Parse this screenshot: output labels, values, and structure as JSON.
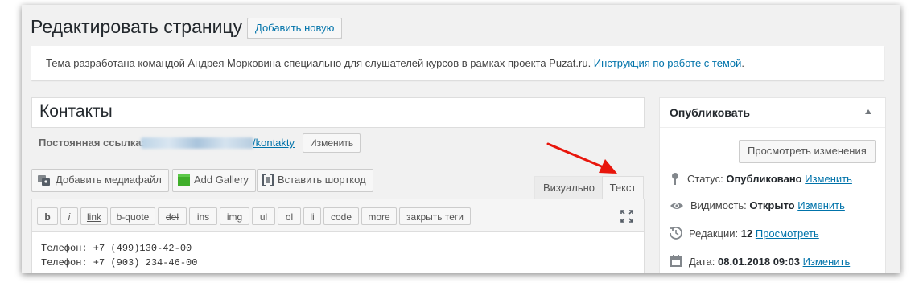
{
  "header": {
    "title": "Редактировать страницу",
    "add_new_label": "Добавить новую"
  },
  "notice": {
    "text": "Тема разработана командой Андрея Морковина специально для слушателей курсов в рамках проекта Puzat.ru. ",
    "link": "Инструкция по работе с темой",
    "suffix": "."
  },
  "post": {
    "title": "Контакты",
    "permalink_label": "Постоянная ссылка:",
    "permalink_slug": "/kontakty",
    "edit_link_label": "Изменить"
  },
  "media_buttons": {
    "add_media": "Добавить медиафайл",
    "add_gallery": "Add Gallery",
    "insert_shortcode": "Вставить шорткод"
  },
  "editor_tabs": {
    "visual": "Визуально",
    "text": "Текст",
    "active": "text"
  },
  "quicktags": [
    "b",
    "i",
    "link",
    "b-quote",
    "del",
    "ins",
    "img",
    "ul",
    "ol",
    "li",
    "code",
    "more",
    "закрыть теги"
  ],
  "content": {
    "lines": [
      "Телефон: +7 (499)130-42-00",
      "Телефон: +7 (903) 234-46-00"
    ]
  },
  "publish": {
    "title": "Опубликовать",
    "preview_label": "Просмотреть изменения",
    "status_label": "Статус:",
    "status_value": "Опубликовано",
    "status_edit": "Изменить",
    "visibility_label": "Видимость:",
    "visibility_value": "Открыто",
    "visibility_edit": "Изменить",
    "revisions_label": "Редакции:",
    "revisions_value": "12",
    "revisions_link": "Просмотреть",
    "date_label": "Дата:",
    "date_value": "08.01.2018 09:03",
    "date_edit": "Изменить"
  },
  "colors": {
    "link": "#0073aa",
    "annotation_arrow": "#e8160c",
    "gallery_icon": "#3fae2a"
  },
  "icons": [
    "media-icon",
    "gallery-icon",
    "shortcode-icon",
    "fullscreen-icon",
    "pin-icon",
    "eye-icon",
    "history-icon",
    "calendar-icon",
    "collapse-arrow-icon",
    "annotation-arrow"
  ]
}
